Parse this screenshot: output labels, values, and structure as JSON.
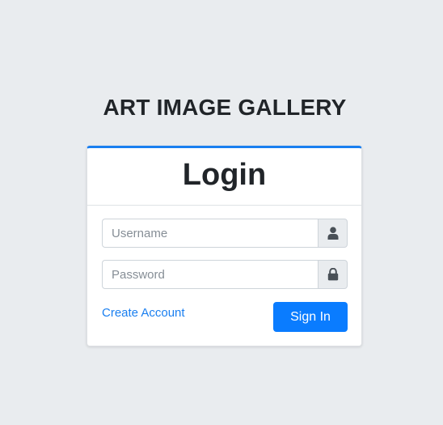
{
  "app": {
    "title": "ART IMAGE GALLERY"
  },
  "login": {
    "heading": "Login",
    "username": {
      "placeholder": "Username",
      "value": "",
      "icon": "user-icon"
    },
    "password": {
      "placeholder": "Password",
      "value": "",
      "icon": "lock-icon"
    },
    "create_account_label": "Create Account",
    "sign_in_label": "Sign In"
  },
  "colors": {
    "background": "#e9ecef",
    "accent": "#0a7cff",
    "link": "#1a7ff0",
    "card_border_top": "#1a7ff0"
  }
}
